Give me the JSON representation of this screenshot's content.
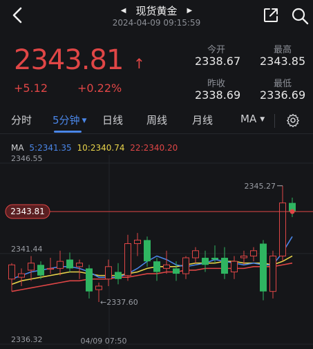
{
  "header": {
    "title": "现货黄金",
    "timestamp": "2024-04-09 09:15:59",
    "prev_icon": "triangle-left-icon",
    "next_icon": "triangle-right-icon"
  },
  "quote": {
    "price": "2343.81",
    "direction_icon": "arrow-up-icon",
    "change": "+5.12",
    "change_pct": "+0.22%",
    "stats": [
      {
        "label": "今开",
        "value": "2338.67"
      },
      {
        "label": "最高",
        "value": "2343.85"
      },
      {
        "label": "昨收",
        "value": "2338.69"
      },
      {
        "label": "最低",
        "value": "2336.69"
      }
    ],
    "up_color": "#e04646"
  },
  "tabs": {
    "items": [
      "分时",
      "5分钟",
      "日线",
      "周线",
      "月线",
      "MA"
    ],
    "active": "5分钟",
    "accent": "#4a86e8"
  },
  "ma_legend": {
    "prefix": "MA",
    "ma5": "5:2341.35",
    "ma10": "10:2340.74",
    "ma22": "22:2340.20",
    "ma5_color": "#4a86e8",
    "ma10_color": "#e9d44a",
    "ma22_color": "#e04646"
  },
  "chart_data": {
    "type": "candlestick",
    "y_ticks": [
      "2346.55",
      "2341.44",
      "2336.32"
    ],
    "ylim": [
      2336.32,
      2346.55
    ],
    "current_price_label": "2343.81",
    "high_annotation": "2345.27",
    "low_annotation": "2337.60",
    "x_label": "04/09 07:50",
    "up_color": "#e04646",
    "down_color": "#2fb561",
    "candles": [
      {
        "o": 2340.0,
        "h": 2340.9,
        "l": 2339.3,
        "c": 2340.8
      },
      {
        "o": 2340.1,
        "h": 2340.6,
        "l": 2339.6,
        "c": 2340.3
      },
      {
        "o": 2340.5,
        "h": 2341.3,
        "l": 2339.9,
        "c": 2340.9
      },
      {
        "o": 2340.8,
        "h": 2341.0,
        "l": 2340.0,
        "c": 2340.2
      },
      {
        "o": 2340.6,
        "h": 2341.2,
        "l": 2340.3,
        "c": 2340.6
      },
      {
        "o": 2340.6,
        "h": 2341.6,
        "l": 2340.2,
        "c": 2341.0
      },
      {
        "o": 2341.1,
        "h": 2341.5,
        "l": 2340.4,
        "c": 2340.6
      },
      {
        "o": 2340.7,
        "h": 2341.1,
        "l": 2340.0,
        "c": 2340.9
      },
      {
        "o": 2340.6,
        "h": 2340.8,
        "l": 2338.9,
        "c": 2339.3
      },
      {
        "o": 2339.4,
        "h": 2339.8,
        "l": 2338.7,
        "c": 2339.6
      },
      {
        "o": 2340.0,
        "h": 2341.1,
        "l": 2339.6,
        "c": 2340.7
      },
      {
        "o": 2340.4,
        "h": 2340.9,
        "l": 2339.7,
        "c": 2340.0
      },
      {
        "o": 2340.2,
        "h": 2342.5,
        "l": 2339.9,
        "c": 2342.0
      },
      {
        "o": 2342.0,
        "h": 2342.6,
        "l": 2341.3,
        "c": 2342.2
      },
      {
        "o": 2342.2,
        "h": 2342.4,
        "l": 2340.7,
        "c": 2341.0
      },
      {
        "o": 2341.0,
        "h": 2341.2,
        "l": 2339.9,
        "c": 2340.4
      },
      {
        "o": 2340.6,
        "h": 2341.6,
        "l": 2340.3,
        "c": 2340.8
      },
      {
        "o": 2340.6,
        "h": 2341.0,
        "l": 2339.9,
        "c": 2340.3
      },
      {
        "o": 2340.3,
        "h": 2341.3,
        "l": 2340.0,
        "c": 2341.2
      },
      {
        "o": 2341.2,
        "h": 2341.8,
        "l": 2340.9,
        "c": 2341.6
      },
      {
        "o": 2341.2,
        "h": 2341.6,
        "l": 2340.4,
        "c": 2340.8
      },
      {
        "o": 2341.2,
        "h": 2341.9,
        "l": 2340.9,
        "c": 2341.1
      },
      {
        "o": 2341.2,
        "h": 2341.8,
        "l": 2340.0,
        "c": 2340.3
      },
      {
        "o": 2340.4,
        "h": 2341.3,
        "l": 2340.0,
        "c": 2341.0
      },
      {
        "o": 2341.2,
        "h": 2341.6,
        "l": 2340.8,
        "c": 2341.3
      },
      {
        "o": 2341.3,
        "h": 2341.8,
        "l": 2341.0,
        "c": 2341.6
      },
      {
        "o": 2342.0,
        "h": 2342.2,
        "l": 2338.8,
        "c": 2339.3
      },
      {
        "o": 2339.3,
        "h": 2341.6,
        "l": 2338.9,
        "c": 2341.3
      },
      {
        "o": 2341.3,
        "h": 2345.27,
        "l": 2341.0,
        "c": 2344.3
      },
      {
        "o": 2344.3,
        "h": 2344.6,
        "l": 2343.5,
        "c": 2343.81
      }
    ],
    "ma5": [
      2340.0,
      2340.2,
      2340.4,
      2340.5,
      2340.6,
      2340.7,
      2340.7,
      2340.6,
      2340.4,
      2340.1,
      2340.1,
      2340.1,
      2340.3,
      2340.6,
      2341.0,
      2341.3,
      2341.1,
      2340.8,
      2340.7,
      2340.8,
      2340.9,
      2341.1,
      2341.0,
      2340.9,
      2340.8,
      2340.9,
      2340.8,
      2340.8,
      2341.5,
      2342.4
    ],
    "ma10": [
      2339.7,
      2339.9,
      2340.0,
      2340.1,
      2340.2,
      2340.3,
      2340.4,
      2340.4,
      2340.3,
      2340.2,
      2340.2,
      2340.2,
      2340.3,
      2340.4,
      2340.6,
      2340.7,
      2340.7,
      2340.7,
      2340.8,
      2340.9,
      2340.9,
      2340.9,
      2341.0,
      2341.0,
      2340.9,
      2340.9,
      2340.9,
      2340.8,
      2341.0,
      2341.3
    ],
    "ma22": [
      2339.3,
      2339.4,
      2339.5,
      2339.6,
      2339.7,
      2339.8,
      2339.9,
      2339.9,
      2340.0,
      2340.0,
      2340.0,
      2340.1,
      2340.1,
      2340.2,
      2340.3,
      2340.3,
      2340.4,
      2340.4,
      2340.5,
      2340.5,
      2340.6,
      2340.6,
      2340.6,
      2340.6,
      2340.6,
      2340.7,
      2340.7,
      2340.7,
      2340.8,
      2340.9
    ]
  }
}
